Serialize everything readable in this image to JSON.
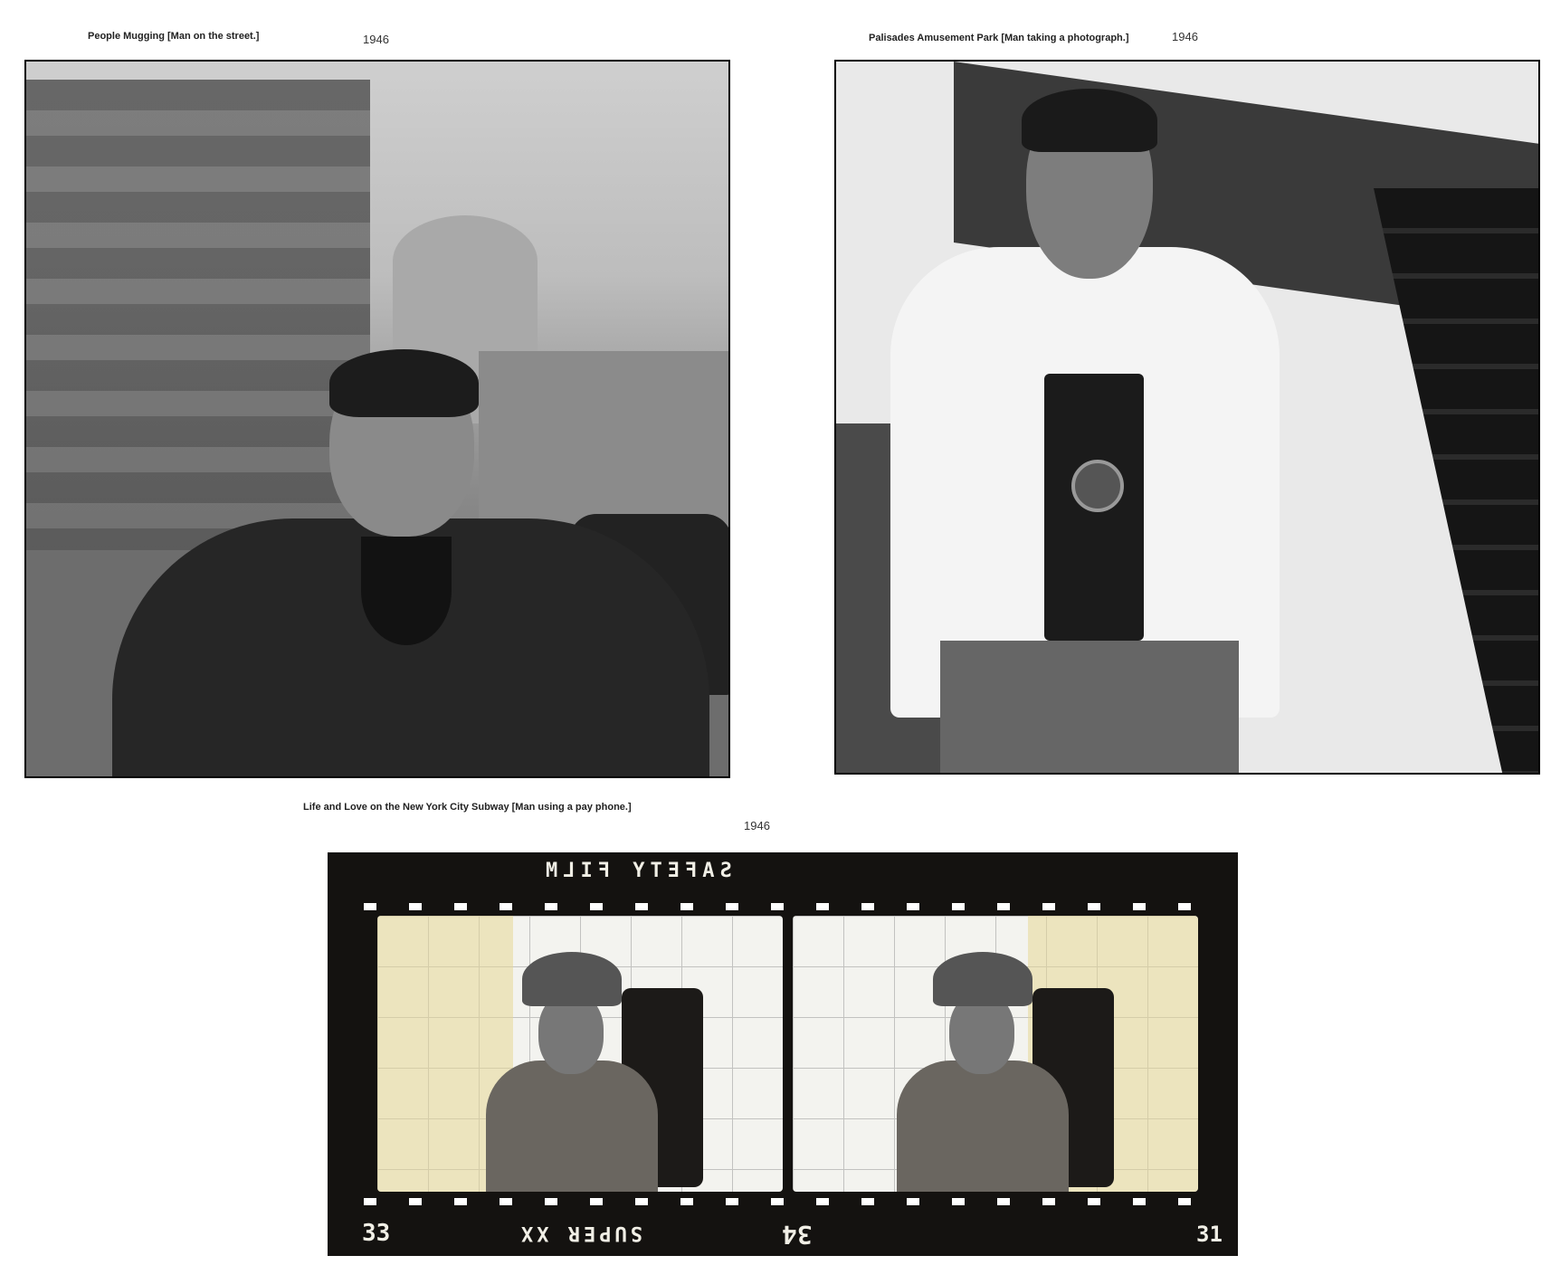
{
  "photos": [
    {
      "caption": "People Mugging [Man on the street.]",
      "year": "1946"
    },
    {
      "caption": "Palisades Amusement Park [Man taking a photograph.]",
      "year": "1946"
    },
    {
      "caption": "Life and Love on the New York City Subway [Man using a pay phone.]",
      "year": "1946",
      "film_edge_text": {
        "top": "SAFETY FILM",
        "bottom": "SUPER XX",
        "frame_left": "33",
        "frame_mid": "34",
        "frame_right": "31"
      }
    }
  ]
}
